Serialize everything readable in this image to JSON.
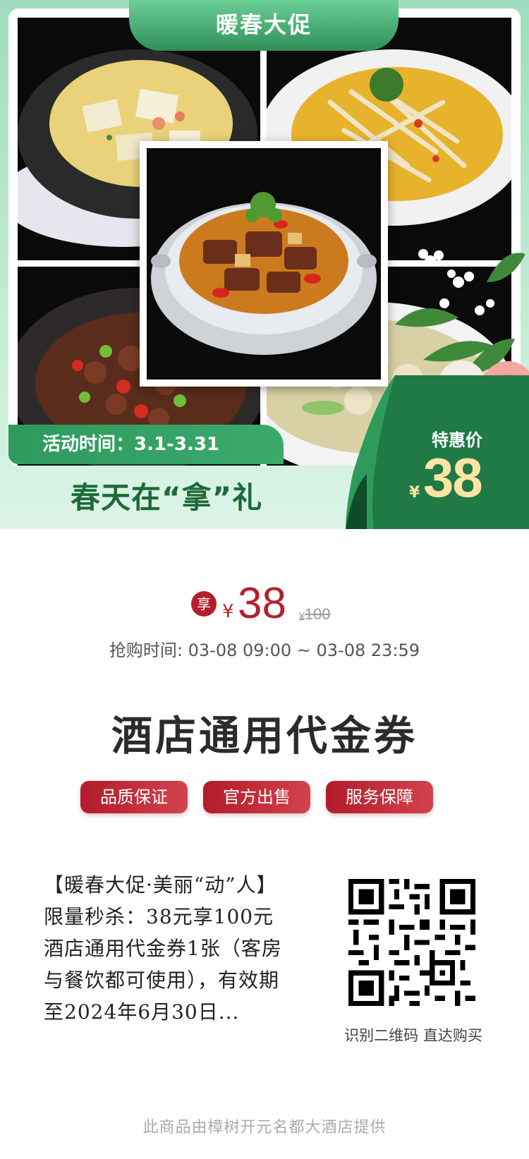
{
  "banner": {
    "promo_title": "暖春大促",
    "activity_time": "活动时间：3.1-3.31",
    "slogan": "春天在“拿”礼",
    "special_label": "特惠价",
    "special_currency": "¥",
    "special_price": "38"
  },
  "price": {
    "badge": "享",
    "currency": "¥",
    "current": "38",
    "original_currency": "¥",
    "original": "100",
    "buy_time": "抢购时间:  03-08 09:00 ~ 03-08 23:59"
  },
  "product": {
    "title": "酒店通用代金券",
    "tags": [
      "品质保证",
      "官方出售",
      "服务保障"
    ],
    "description": "【暖春大促·美丽“动”人】限量秒杀：38元享100元酒店通用代金券1张（客房与餐饮都可使用），有效期至2024年6月30日..."
  },
  "qr": {
    "caption": "识别二维码 直达购买"
  },
  "footer": {
    "provider": "此商品由樟树开元名都大酒店提供"
  },
  "colors": {
    "brand_green": "#2f9a5e",
    "price_red": "#b3202c",
    "ribbon_gold": "#ffe5a3"
  }
}
